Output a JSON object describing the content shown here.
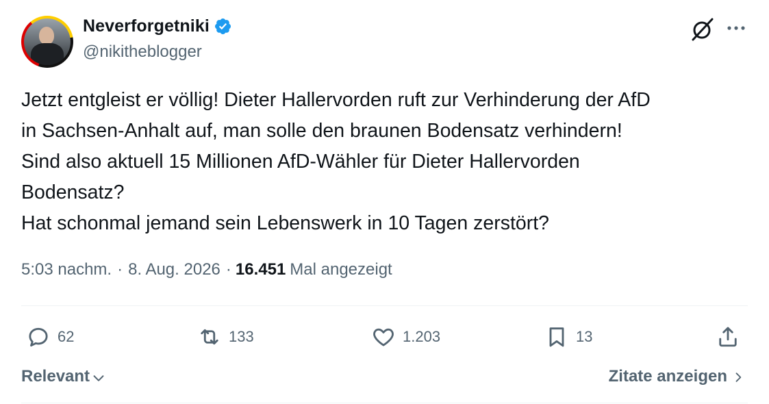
{
  "author": {
    "display_name": "Neverforgetniki",
    "handle": "@nikitheblogger",
    "verified_icon": "verified-badge-icon"
  },
  "header_icons": [
    "grok-icon",
    "more-icon"
  ],
  "tweet": {
    "text": "Jetzt entgleist er völlig! Dieter Hallervorden ruft zur Verhinderung der AfD\nin Sachsen-Anhalt auf, man solle den braunen Bodensatz verhindern!\nSind also aktuell 15 Millionen AfD-Wähler für Dieter Hallervorden\nBodensatz?\nHat schonmal jemand sein Lebenswerk in 10 Tagen zerstört?",
    "time": "5:03 nachm.",
    "separator": "·",
    "date": "8. Aug. 2026",
    "views_count": "16.451",
    "views_label": "Mal angezeigt"
  },
  "actions": {
    "replies": "62",
    "reposts": "133",
    "likes": "1.203",
    "bookmarks": "13"
  },
  "footer": {
    "sort_label": "Relevant",
    "quotes_label": "Zitate anzeigen"
  },
  "colors": {
    "text": "#0f1419",
    "secondary": "#536471",
    "verified": "#1d9bf0",
    "divider": "#eff3f4"
  }
}
